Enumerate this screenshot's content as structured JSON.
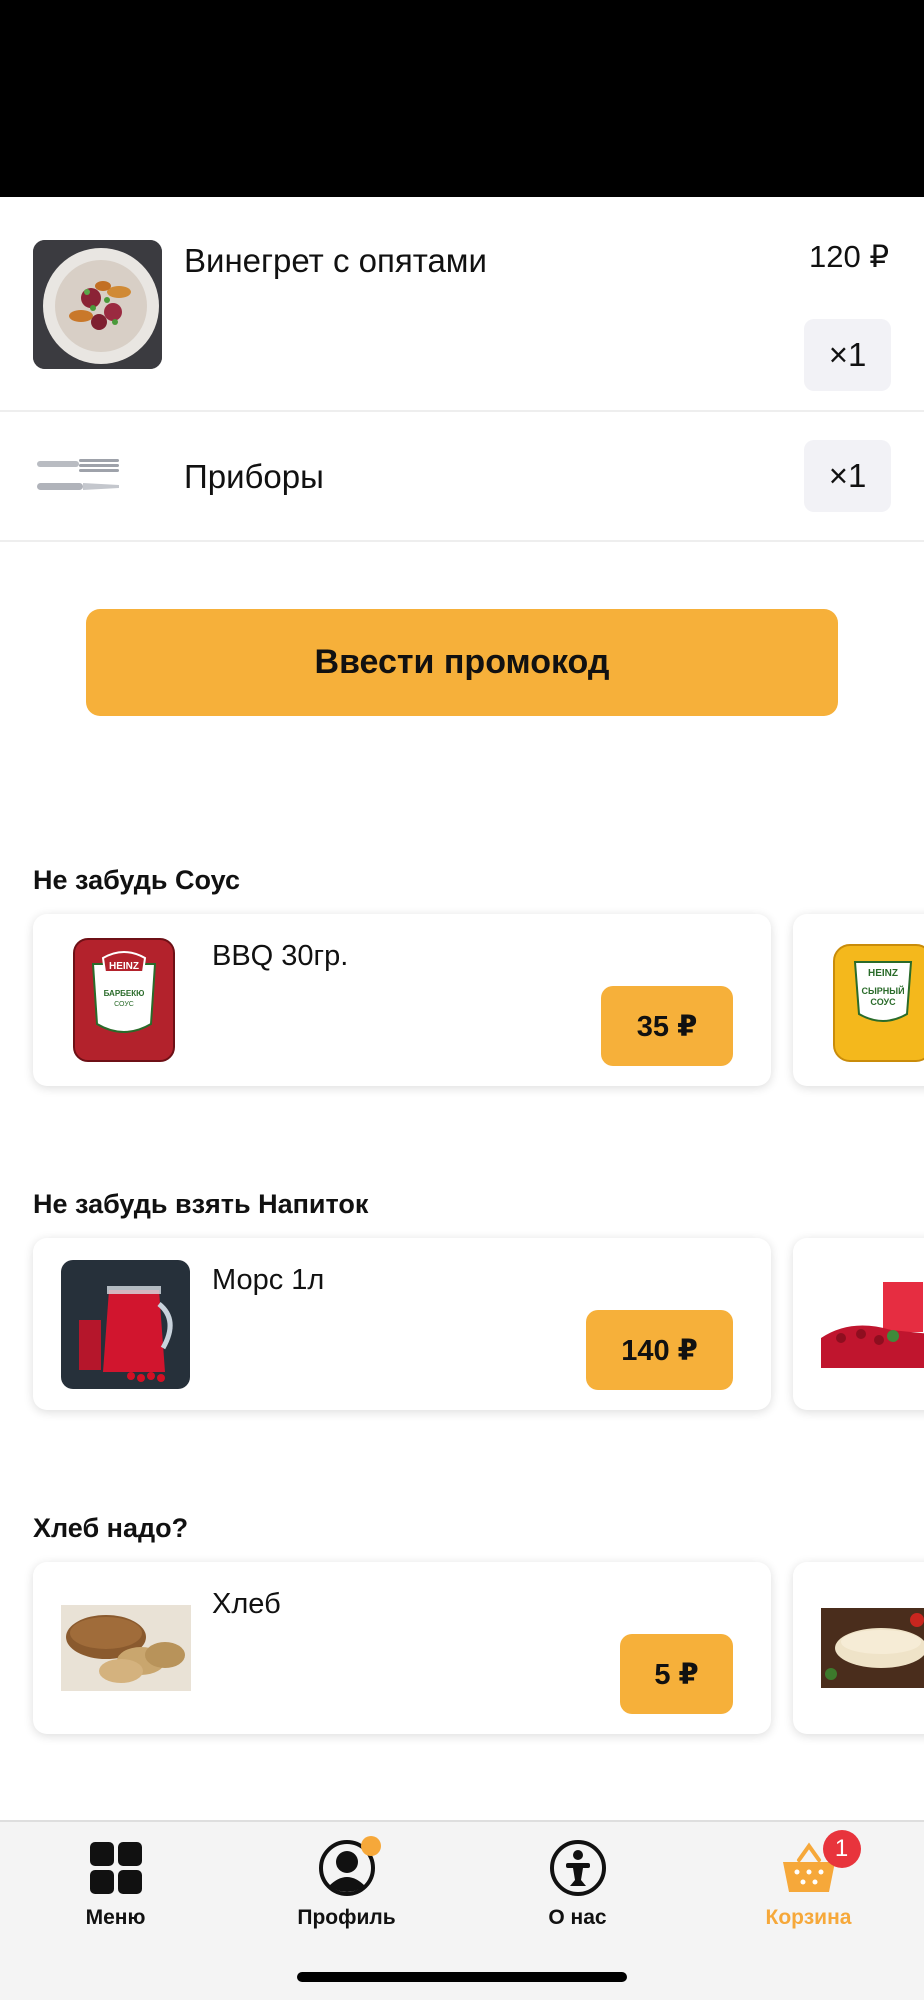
{
  "cart_items": [
    {
      "name": "Винегрет с опятами",
      "price": "120 ₽",
      "qty": "×1"
    },
    {
      "name": "Приборы",
      "qty": "×1"
    }
  ],
  "promo": {
    "label": "Ввести промокод"
  },
  "sections": [
    {
      "title": "Не забудь Соус",
      "card": {
        "name": "BBQ 30гр.",
        "price": "35 ₽",
        "image_text": [
          "HEINZ",
          "БАРБЕКЬЮ",
          "СОУС"
        ]
      },
      "peek_image_text": [
        "HEINZ",
        "СЫРНЫЙ",
        "СОУС"
      ]
    },
    {
      "title": "Не забудь взять Напиток",
      "card": {
        "name": "Морс 1л",
        "price": "140 ₽"
      }
    },
    {
      "title": "Хлеб надо?",
      "card": {
        "name": "Хлеб",
        "price": "5 ₽"
      }
    }
  ],
  "tabbar": {
    "tabs": [
      {
        "label": "Меню",
        "icon": "grid-icon"
      },
      {
        "label": "Профиль",
        "icon": "profile-icon"
      },
      {
        "label": "О нас",
        "icon": "info-person-icon"
      },
      {
        "label": "Корзина",
        "icon": "basket-icon",
        "badge": "1",
        "active": true
      }
    ]
  },
  "colors": {
    "accent": "#f6b03a",
    "badge": "#e8343c",
    "active_tab": "#f6a83a"
  }
}
